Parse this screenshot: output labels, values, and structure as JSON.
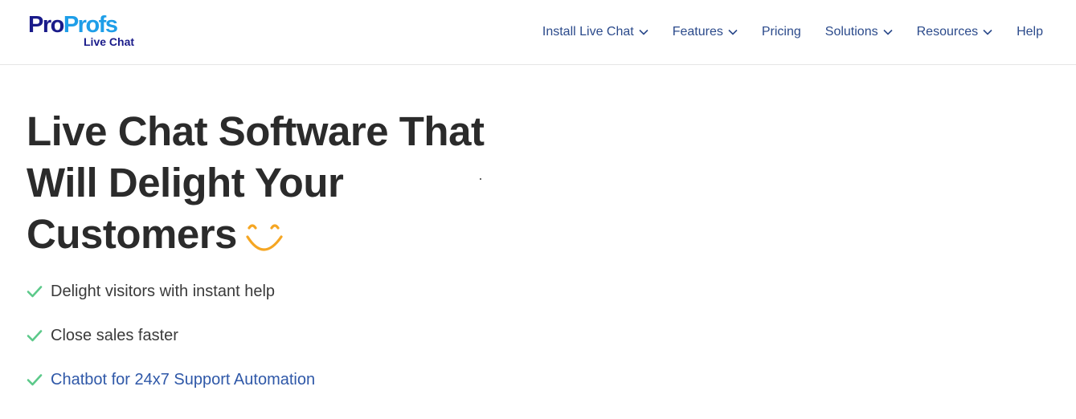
{
  "header": {
    "logo": {
      "part1": "Pro",
      "part2": "Profs",
      "sub": "Live Chat"
    },
    "nav": [
      {
        "label": "Install Live Chat",
        "dropdown": true
      },
      {
        "label": "Features",
        "dropdown": true
      },
      {
        "label": "Pricing",
        "dropdown": false
      },
      {
        "label": "Solutions",
        "dropdown": true
      },
      {
        "label": "Resources",
        "dropdown": true
      },
      {
        "label": "Help",
        "dropdown": false
      }
    ]
  },
  "hero": {
    "title_lines": [
      "Live Chat Software That",
      "Will Delight Your",
      "Customers"
    ],
    "bullets": [
      {
        "text": "Delight visitors with instant help",
        "link": false
      },
      {
        "text": "Close sales faster",
        "link": false
      },
      {
        "text": "Chatbot for 24x7 Support Automation",
        "link": true
      }
    ]
  },
  "colors": {
    "brand_dark": "#1a1b8a",
    "brand_light": "#1e9ee8",
    "nav_text": "#2b4a8b",
    "heading": "#2b2b2b",
    "check_green": "#5cc98a",
    "link_blue": "#2f58a8",
    "smile_orange": "#f5a623"
  },
  "icons": {
    "nav_dropdown": "chevron-down-icon",
    "bullet": "check-icon",
    "title_emoji": "smile-icon"
  }
}
